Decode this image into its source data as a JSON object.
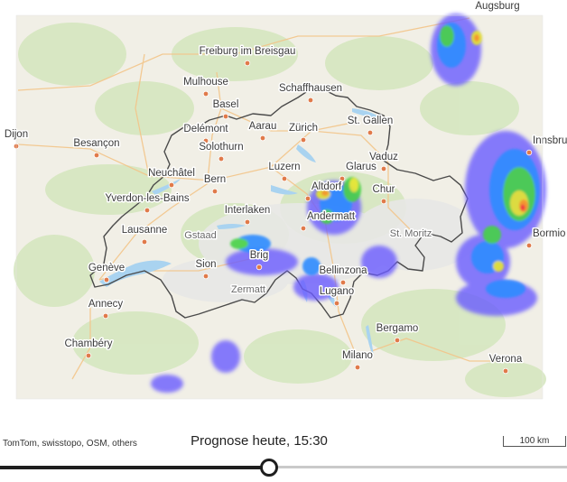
{
  "map": {
    "cities": [
      {
        "name": "Augsburg",
        "type": "major"
      },
      {
        "name": "Freiburg im Breisgau",
        "type": "major"
      },
      {
        "name": "Mulhouse",
        "type": "major"
      },
      {
        "name": "Basel",
        "type": "major"
      },
      {
        "name": "Schaffhausen",
        "type": "major"
      },
      {
        "name": "St. Gallen",
        "type": "major"
      },
      {
        "name": "Dijon",
        "type": "major"
      },
      {
        "name": "Delémont",
        "type": "major"
      },
      {
        "name": "Aarau",
        "type": "major"
      },
      {
        "name": "Zürich",
        "type": "major"
      },
      {
        "name": "Besançon",
        "type": "major"
      },
      {
        "name": "Solothurn",
        "type": "major"
      },
      {
        "name": "Vaduz",
        "type": "major"
      },
      {
        "name": "Innsbruck",
        "type": "major"
      },
      {
        "name": "Luzern",
        "type": "major"
      },
      {
        "name": "Glarus",
        "type": "major"
      },
      {
        "name": "Neuchâtel",
        "type": "major"
      },
      {
        "name": "Bern",
        "type": "major"
      },
      {
        "name": "Altdorf",
        "type": "major"
      },
      {
        "name": "Chur",
        "type": "major"
      },
      {
        "name": "Yverdon-les-Bains",
        "type": "major"
      },
      {
        "name": "Interlaken",
        "type": "major"
      },
      {
        "name": "Andermatt",
        "type": "major"
      },
      {
        "name": "Lausanne",
        "type": "major"
      },
      {
        "name": "Gstaad",
        "type": "minor"
      },
      {
        "name": "St. Moritz",
        "type": "minor"
      },
      {
        "name": "Bormio",
        "type": "major"
      },
      {
        "name": "Brig",
        "type": "major"
      },
      {
        "name": "Sion",
        "type": "major"
      },
      {
        "name": "Genève",
        "type": "major"
      },
      {
        "name": "Bellinzona",
        "type": "major"
      },
      {
        "name": "Zermatt",
        "type": "minor"
      },
      {
        "name": "Lugano",
        "type": "major"
      },
      {
        "name": "Annecy",
        "type": "major"
      },
      {
        "name": "Bergamo",
        "type": "major"
      },
      {
        "name": "Chambéry",
        "type": "major"
      },
      {
        "name": "Milano",
        "type": "major"
      },
      {
        "name": "Verona",
        "type": "major"
      }
    ],
    "colors": {
      "land": "#f1efe6",
      "forest": "#cfe3b6",
      "lake": "#a9d3f0",
      "border": "#4a4a4a",
      "road": "#f6c98b",
      "city_dot": "#e07a4a",
      "radar": [
        "#6a5cff",
        "#2d8cff",
        "#2fd6d6",
        "#46d246",
        "#e6e62e",
        "#ff9a1e",
        "#ff2e2e"
      ]
    }
  },
  "footer": {
    "attribution": "TomTom, swisstopo, OSM, others",
    "title": "Prognose heute, 15:30",
    "scale": "100 km"
  },
  "timeline": {
    "progress": 0.475
  }
}
